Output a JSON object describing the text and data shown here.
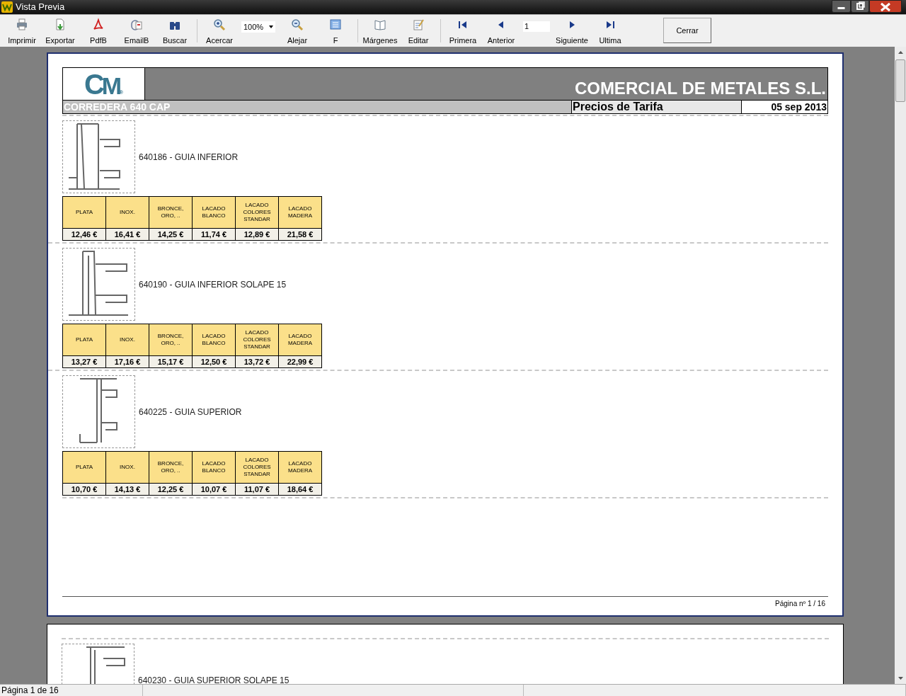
{
  "window": {
    "title": "Vista Previa"
  },
  "toolbar": {
    "groups": [
      {
        "items": [
          {
            "kind": "button",
            "label": "Imprimir"
          },
          {
            "kind": "button",
            "label": "Exportar"
          },
          {
            "kind": "button",
            "label": "PdfB"
          },
          {
            "kind": "button",
            "label": "EmailB"
          },
          {
            "kind": "button",
            "label": "Buscar"
          }
        ]
      },
      {
        "items": [
          {
            "kind": "button",
            "label": "Acercar"
          },
          {
            "kind": "select",
            "value": "100%"
          },
          {
            "kind": "button",
            "label": "Alejar"
          },
          {
            "kind": "button",
            "label": "F"
          }
        ]
      },
      {
        "items": [
          {
            "kind": "button",
            "label": "Márgenes"
          },
          {
            "kind": "button",
            "label": "Editar"
          }
        ]
      },
      {
        "items": [
          {
            "kind": "button",
            "label": "Primera"
          },
          {
            "kind": "button",
            "label": "Anterior"
          },
          {
            "kind": "input",
            "value": "1"
          },
          {
            "kind": "button",
            "label": "Siguiente"
          },
          {
            "kind": "button",
            "label": "Ultima"
          }
        ]
      }
    ],
    "close_button": "Cerrar"
  },
  "pages": [
    {
      "header": {
        "logo": {
          "text": "CM",
          "mark": "®"
        },
        "company": "COMERCIAL DE METALES S.L.",
        "series": "CORREDERA 640 CAP",
        "report_title": "Precios de Tarifa",
        "date": "05 sep 2013"
      },
      "products": [
        {
          "title": "640186 - GUIA INFERIOR",
          "columns": [
            "PLATA",
            "INOX.",
            "BRONCE, ORO, ..",
            "LACADO BLANCO",
            "LACADO COLORES STANDAR",
            "LACADO MADERA"
          ],
          "prices": [
            "12,46 €",
            "16,41 €",
            "14,25 €",
            "11,74 €",
            "12,89 €",
            "21,58 €"
          ]
        },
        {
          "title": "640190 - GUIA INFERIOR SOLAPE 15",
          "columns": [
            "PLATA",
            "INOX.",
            "BRONCE, ORO, ..",
            "LACADO BLANCO",
            "LACADO COLORES STANDAR",
            "LACADO MADERA"
          ],
          "prices": [
            "13,27 €",
            "17,16 €",
            "15,17 €",
            "12,50 €",
            "13,72 €",
            "22,99 €"
          ]
        },
        {
          "title": "640225 - GUIA SUPERIOR",
          "columns": [
            "PLATA",
            "INOX.",
            "BRONCE, ORO, ..",
            "LACADO BLANCO",
            "LACADO COLORES STANDAR",
            "LACADO MADERA"
          ],
          "prices": [
            "10,70 €",
            "14,13 €",
            "12,25 €",
            "10,07 €",
            "11,07 €",
            "18,64 €"
          ]
        }
      ],
      "footer": "Página nº 1 / 16"
    },
    {
      "products": [
        {
          "title": "640230 - GUIA SUPERIOR SOLAPE 15"
        }
      ]
    }
  ],
  "status_bar": [
    "Página 1 de 16"
  ]
}
